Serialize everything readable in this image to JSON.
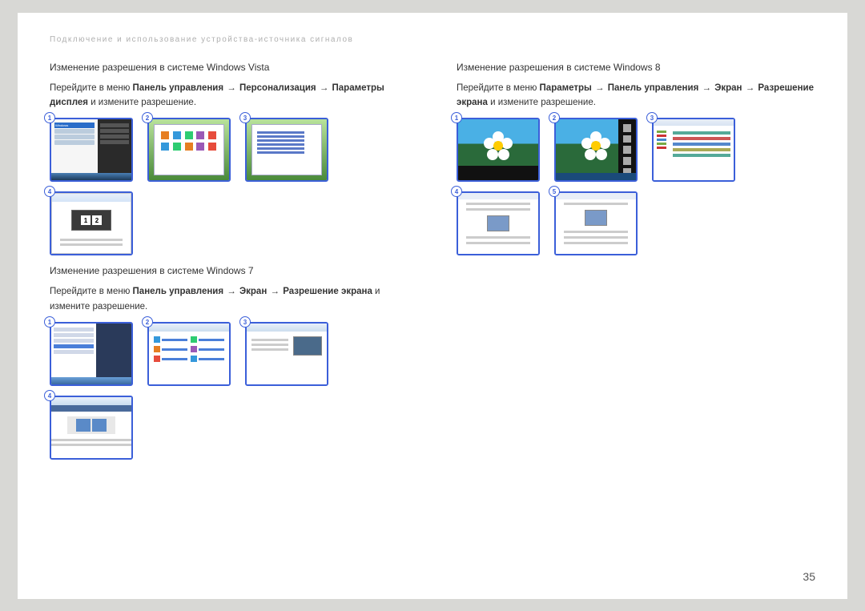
{
  "page": {
    "breadcrumb": "Подключение и использование устройства-источника сигналов",
    "number": "35"
  },
  "left": {
    "vista": {
      "title": "Изменение разрешения в системе Windows Vista",
      "desc_prefix": "Перейдите в меню ",
      "path1": "Панель управления",
      "path2": "Персонализация",
      "path3": "Параметры дисплея",
      "desc_suffix": " и измените разрешение.",
      "c1": "1",
      "c2": "2",
      "c3": "3",
      "c4": "4"
    },
    "win7": {
      "title": "Изменение разрешения в системе Windows 7",
      "desc_prefix": "Перейдите в меню ",
      "path1": "Панель управления",
      "path2": "Экран",
      "path3": "Разрешение экрана",
      "desc_suffix": " и измените разрешение.",
      "c1": "1",
      "c2": "2",
      "c3": "3",
      "c4": "4"
    }
  },
  "right": {
    "win8": {
      "title": "Изменение разрешения в системе Windows 8",
      "desc_prefix": "Перейдите в меню ",
      "path1": "Параметры",
      "path2": "Панель управления",
      "path3": "Экран",
      "path4": "Разрешение экрана",
      "desc_suffix": " и измените разрешение.",
      "c1": "1",
      "c2": "2",
      "c3": "3",
      "c4": "4",
      "c5": "5"
    }
  },
  "arrow": "→"
}
